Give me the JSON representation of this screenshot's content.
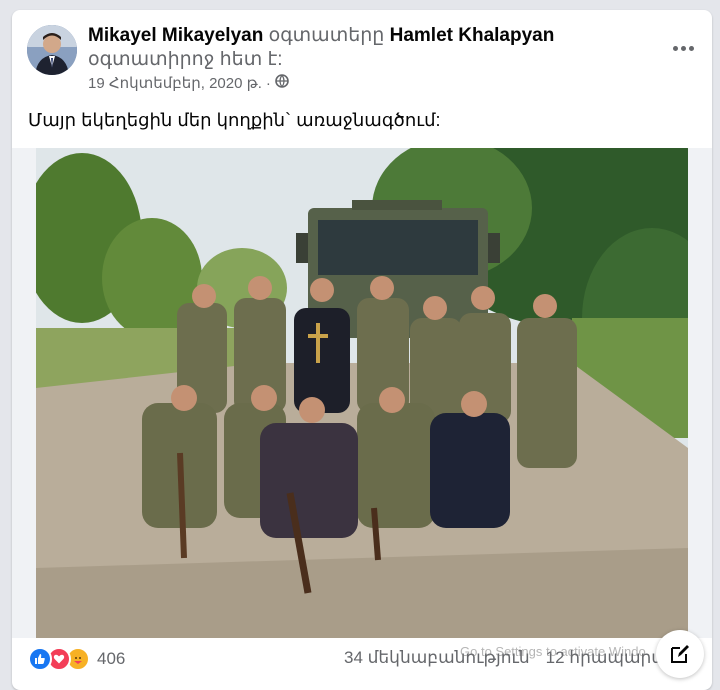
{
  "post": {
    "author": "Mikayel Mikayelyan",
    "connector1": "օգտատերը",
    "tagged": "Hamlet Khalapyan",
    "connector2": "օգտատիրոջ հետ է:",
    "date": "19 Հոկտեմբեր, 2020 թ.",
    "separator": "·",
    "privacy_icon": "globe-icon",
    "caption": "Մայր եկեղեցին մեր կողքին` առաջնագծում:"
  },
  "footer": {
    "reaction_icons": [
      "like-icon",
      "love-icon",
      "care-icon"
    ],
    "reaction_count": "406",
    "comments": "34 մեկնաբանություն",
    "shares": "12 հրապարակ"
  },
  "watermark": "Go to Settings to activate Windo",
  "colors": {
    "like": "#1877f2",
    "love": "#f33e58",
    "care": "#f7b125",
    "secondary_text": "#65676b",
    "background": "#e4e6eb"
  }
}
